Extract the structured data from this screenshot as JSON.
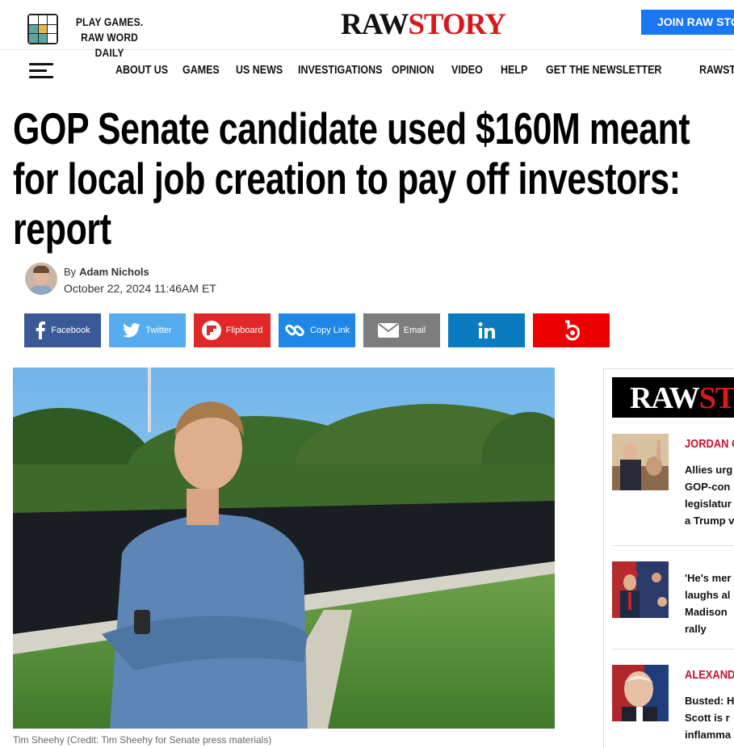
{
  "header": {
    "play_line1": "PLAY GAMES.",
    "play_line2": "RAW WORD DAILY",
    "logo_raw": "RAW",
    "logo_story": "STORY",
    "join_label": "JOIN RAW STORY"
  },
  "nav": {
    "items": [
      "ABOUT US",
      "GAMES",
      "US NEWS",
      "INVESTIGATIONS",
      "OPINION",
      "VIDEO",
      "HELP",
      "GET THE NEWSLETTER",
      "RAWSTORY"
    ]
  },
  "article": {
    "headline": "GOP Senate candidate used $160M meant for local job creation to pay off investors: report",
    "by": "By",
    "author": "Adam Nichols",
    "date": "October 22, 2024 11:46AM ET",
    "caption": "Tim Sheehy (Credit: Tim Sheehy for Senate press materials)"
  },
  "share": [
    {
      "label": "Facebook",
      "icon": "facebook-icon",
      "color": "#3b5998"
    },
    {
      "label": "Twitter",
      "icon": "twitter-icon",
      "color": "#55acee"
    },
    {
      "label": "Flipboard",
      "icon": "flipboard-icon",
      "color": "#e12828"
    },
    {
      "label": "Copy Link",
      "icon": "link-icon",
      "color": "#1f87e8"
    },
    {
      "label": "Email",
      "icon": "email-icon",
      "color": "#7d7d7d"
    },
    {
      "label": "",
      "icon": "linkedin-icon",
      "color": "#0a7bbf"
    },
    {
      "label": "",
      "icon": "bluesky-icon",
      "color": "#ef0000"
    }
  ],
  "sidebar": {
    "logo_raw": "RAW",
    "logo_story": "STO",
    "items": [
      {
        "tag": "JORDAN G",
        "title": "Allies urg\nGOP-con\nlegislatur\na Trump v"
      },
      {
        "tag": "",
        "title": "'He's mer\nlaughs al\nMadison\nrally"
      },
      {
        "tag": "ALEXANDI",
        "title": "Busted: H\nScott is r\ninflamma"
      }
    ]
  },
  "colors": {
    "brand_red": "#d7191c",
    "join_blue": "#1877f2",
    "tag_red": "#c8102e"
  }
}
